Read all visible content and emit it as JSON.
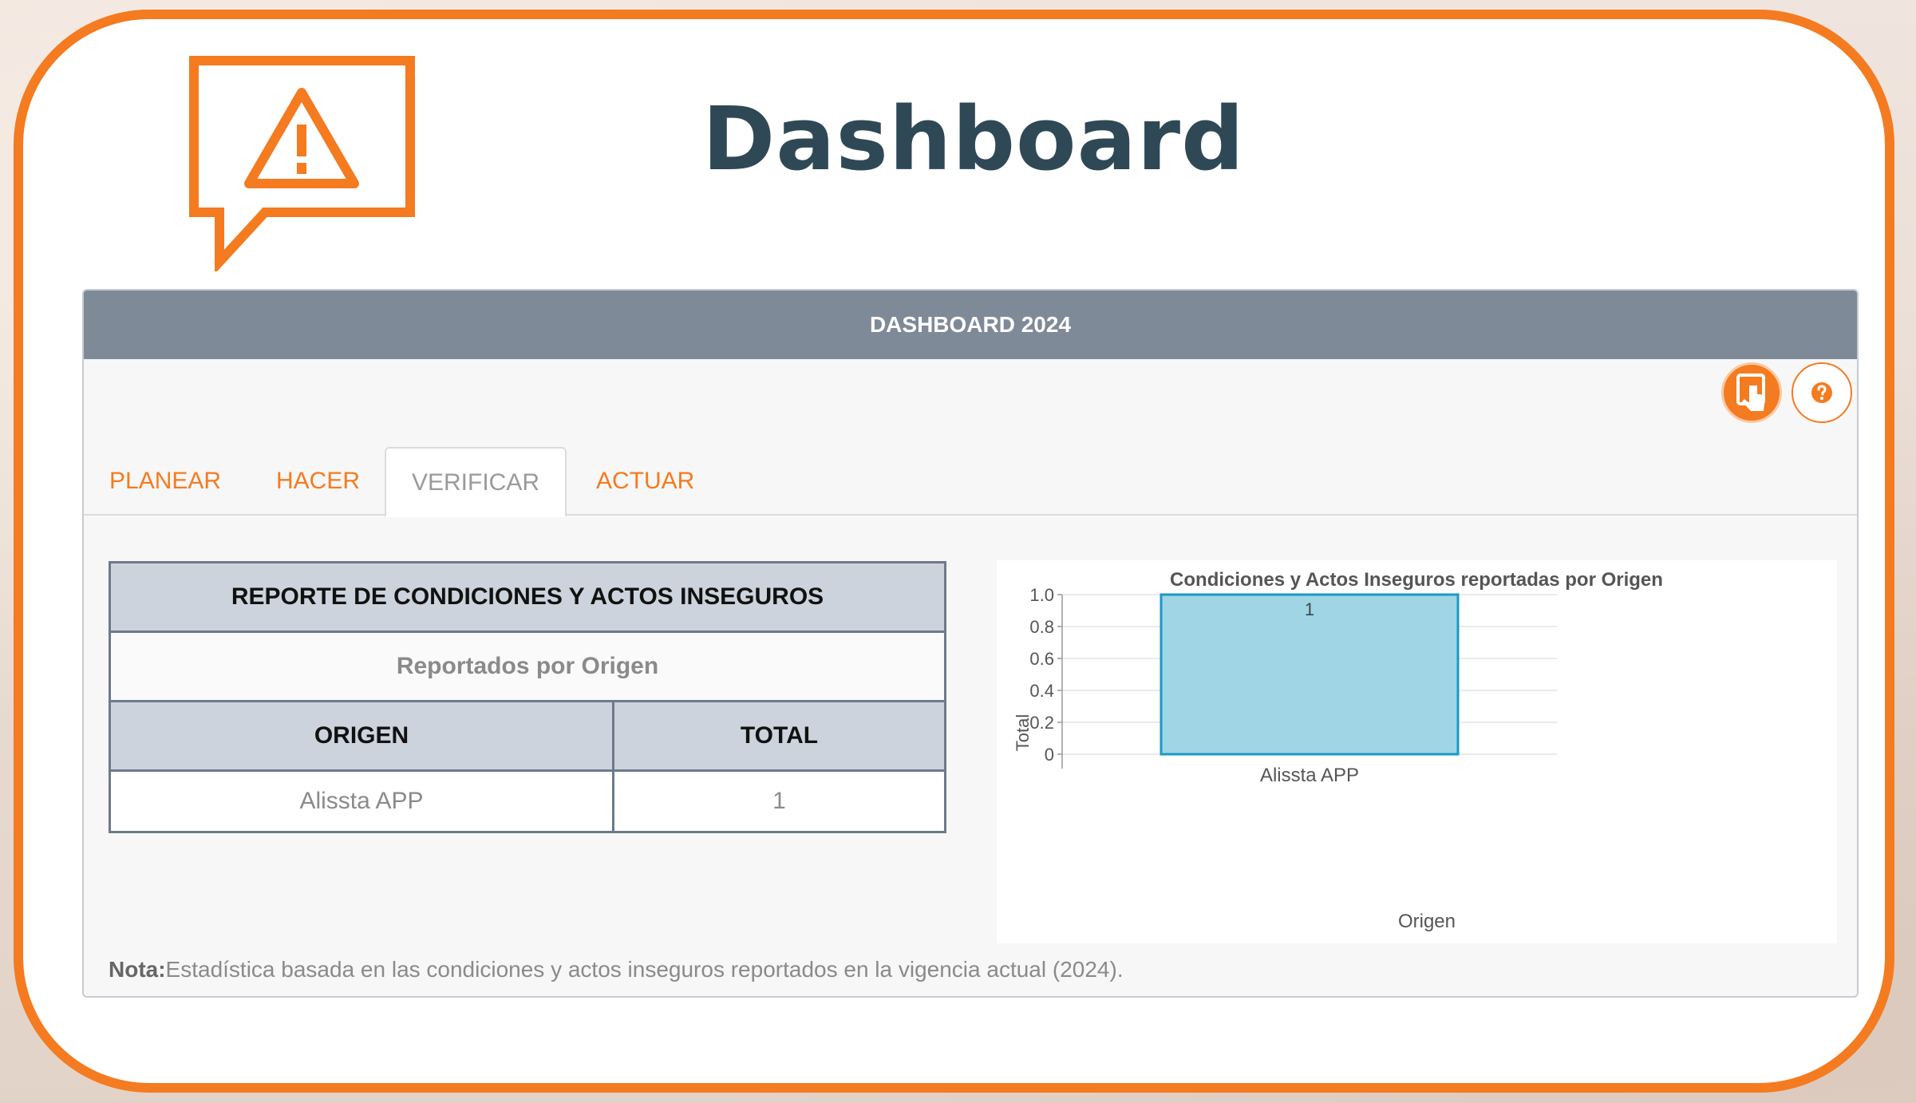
{
  "page": {
    "title": "Dashboard"
  },
  "panel": {
    "header": "DASHBOARD 2024"
  },
  "actions": {
    "touch_icon": "hand-pointer-icon",
    "help_icon": "question-icon"
  },
  "tabs": [
    {
      "label": "PLANEAR",
      "active": false
    },
    {
      "label": "HACER",
      "active": false
    },
    {
      "label": "VERIFICAR",
      "active": true
    },
    {
      "label": "ACTUAR",
      "active": false
    }
  ],
  "report": {
    "title": "REPORTE DE CONDICIONES Y ACTOS INSEGUROS",
    "subtitle": "Reportados por Origen",
    "columns": [
      "ORIGEN",
      "TOTAL"
    ],
    "rows": [
      {
        "origen": "Alissta APP",
        "total": "1"
      }
    ]
  },
  "note": {
    "label": "Nota:",
    "text": "Estadística basada en las condiciones y actos inseguros reportados en la vigencia actual (2024)."
  },
  "colors": {
    "accent": "#f47b20",
    "title": "#2f4856",
    "header": "#7f8a98",
    "bar_fill": "#9fd5e4",
    "bar_stroke": "#1a9ac4"
  },
  "chart_data": {
    "type": "bar",
    "title": "Condiciones y Actos Inseguros reportadas por Origen",
    "xlabel": "Origen",
    "ylabel": "Total",
    "categories": [
      "Alissta APP"
    ],
    "values": [
      1
    ],
    "data_labels": [
      "1"
    ],
    "ylim": [
      0,
      1
    ],
    "yticks": [
      0,
      0.2,
      0.4,
      0.6,
      0.8,
      1.0
    ],
    "ytick_labels": [
      "0",
      "0.2",
      "0.4",
      "0.6",
      "0.8",
      "1.0"
    ],
    "grid": true,
    "legend": "none"
  }
}
